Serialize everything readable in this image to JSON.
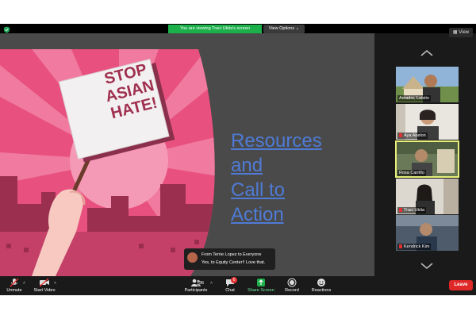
{
  "meeting": {
    "banner_text": "You are viewing Traci Ukita's screen",
    "view_options_label": "View Options ⌄",
    "view_label": "View"
  },
  "slide": {
    "sign_lines": [
      "STOP",
      "ASIAN",
      "HATE!"
    ],
    "links": [
      "Resources",
      "and",
      "Call to",
      "Action"
    ],
    "link_color": "#4f7bd6"
  },
  "gallery": {
    "participants": [
      {
        "name": "Amador, Luisito",
        "muted": false
      },
      {
        "name": "Aya Abelon",
        "muted": true
      },
      {
        "name": "Rosa Carrillo",
        "muted": false
      },
      {
        "name": "Traci Ukita",
        "muted": true
      },
      {
        "name": "Kendrick Kim",
        "muted": true
      }
    ]
  },
  "chat_popup": {
    "from": "From Terrie Lopez to Everyone",
    "message": "Yes, to Equity Center!!  Love that."
  },
  "toolbar": {
    "unmute_label": "Unmute",
    "start_video_label": "Start Video",
    "participants_label": "Participants",
    "participants_count": "36",
    "chat_label": "Chat",
    "chat_badge": "6",
    "share_screen_label": "Share Screen",
    "record_label": "Record",
    "reactions_label": "Reactions",
    "leave_label": "Leave"
  },
  "colors": {
    "share_green": "#1bb04a",
    "leave_red": "#e02828",
    "active_speaker": "#e6f07a"
  }
}
